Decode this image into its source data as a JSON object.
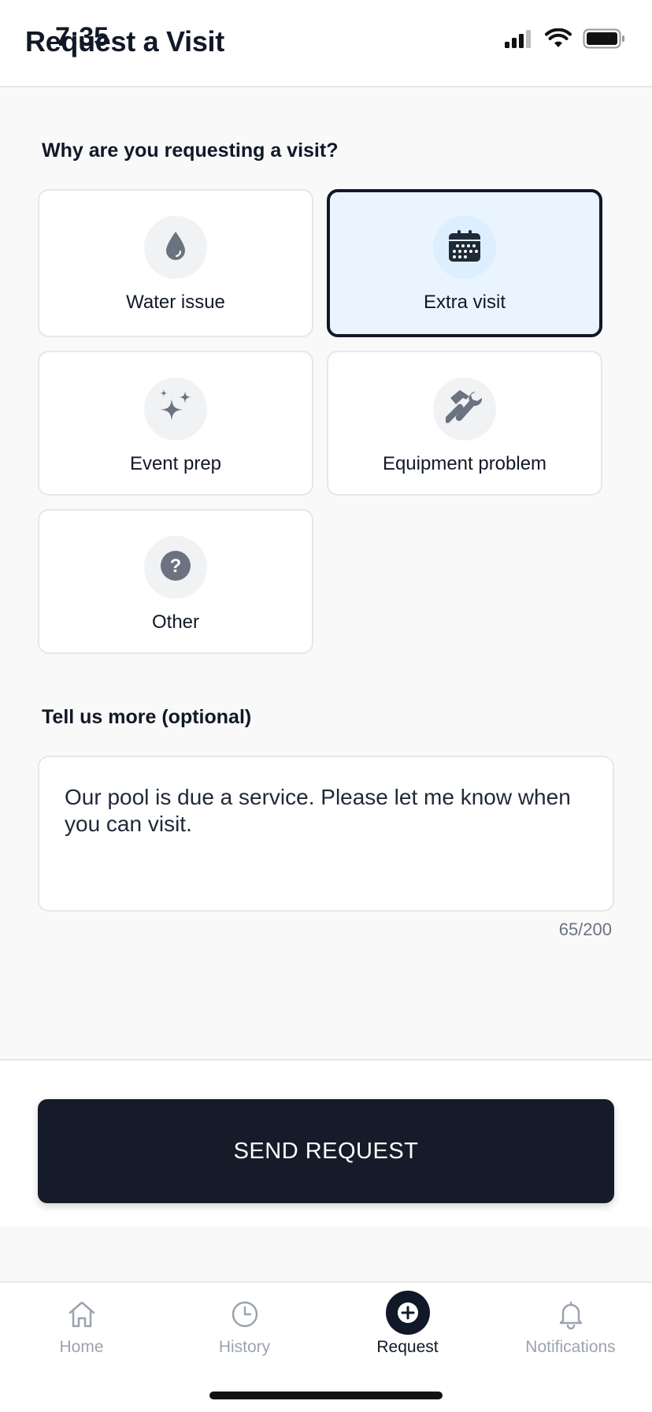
{
  "status_bar": {
    "time": "7:35"
  },
  "header": {
    "title": "Request a Visit"
  },
  "reason_section": {
    "question": "Why are you requesting a visit?",
    "options": [
      {
        "label": "Water issue",
        "icon": "water-drop-icon",
        "selected": false
      },
      {
        "label": "Extra visit",
        "icon": "calendar-icon",
        "selected": true
      },
      {
        "label": "Event prep",
        "icon": "sparkles-icon",
        "selected": false
      },
      {
        "label": "Equipment problem",
        "icon": "tools-icon",
        "selected": false
      },
      {
        "label": "Other",
        "icon": "question-icon",
        "selected": false
      }
    ]
  },
  "details": {
    "label": "Tell us more (optional)",
    "value": "Our pool is due a service. Please let me know when you can visit.",
    "char_count": "65/200"
  },
  "actions": {
    "send_label": "SEND REQUEST"
  },
  "tabbar": {
    "items": [
      {
        "label": "Home",
        "icon": "home-icon",
        "active": false
      },
      {
        "label": "History",
        "icon": "clock-icon",
        "active": false
      },
      {
        "label": "Request",
        "icon": "plus-circle-icon",
        "active": true
      },
      {
        "label": "Notifications",
        "icon": "bell-icon",
        "active": false
      }
    ]
  },
  "colors": {
    "primary": "#151b28",
    "selected_bg": "#eaf4ff",
    "icon_gray": "#6b7280",
    "border": "#e5e7eb",
    "inactive_tab": "#9ca3af"
  }
}
